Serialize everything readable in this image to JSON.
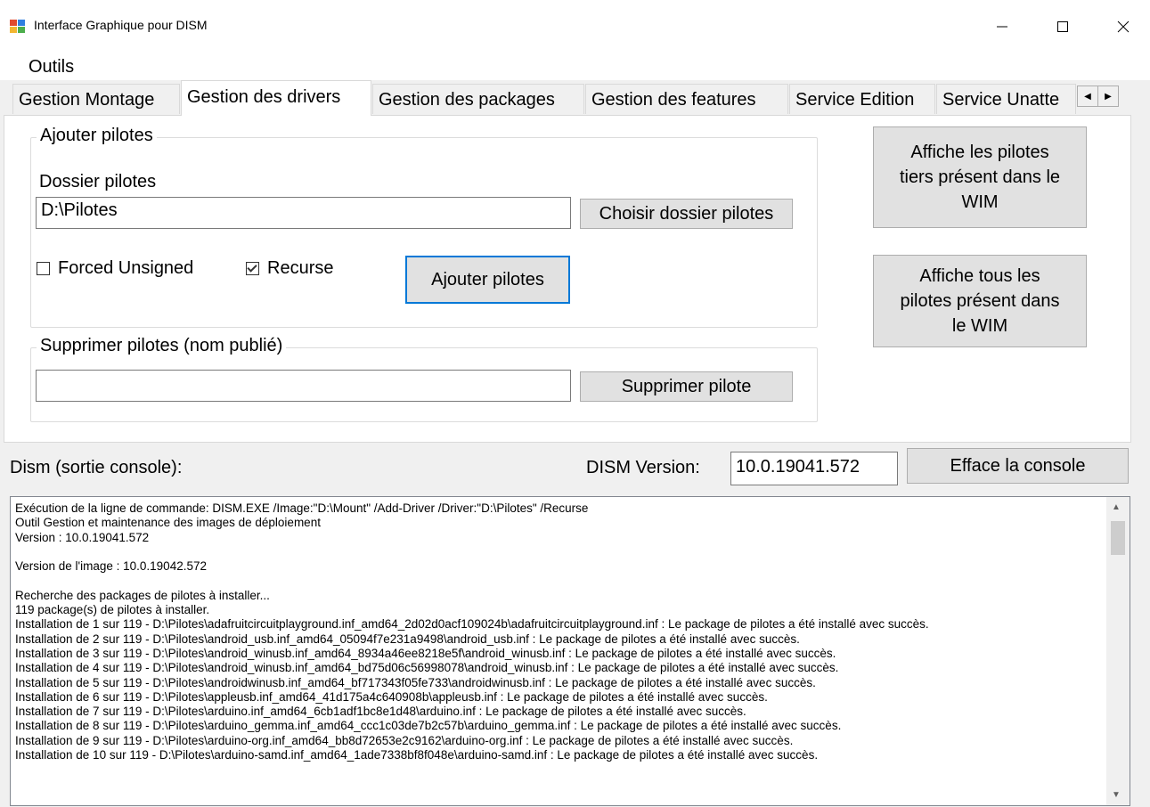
{
  "window": {
    "title": "Interface Graphique pour DISM",
    "minimize_icon": "minimize-icon",
    "maximize_icon": "maximize-icon",
    "close_icon": "close-icon"
  },
  "menu": {
    "items": [
      "Outils"
    ]
  },
  "tabs": [
    "Gestion Montage",
    "Gestion des drivers",
    "Gestion des packages",
    "Gestion des features",
    "Service Edition",
    "Service Unatte"
  ],
  "active_tab": "Gestion des drivers",
  "add_group": {
    "title": "Ajouter pilotes",
    "folder_label": "Dossier pilotes",
    "folder_value": "D:\\Pilotes",
    "choose_button": "Choisir dossier pilotes",
    "forced_unsigned": {
      "label": "Forced Unsigned",
      "checked": false
    },
    "recurse": {
      "label": "Recurse",
      "checked": true
    },
    "add_button": "Ajouter pilotes"
  },
  "remove_group": {
    "title": "Supprimer pilotes (nom publié)",
    "input_value": "",
    "remove_button": "Supprimer pilote"
  },
  "side_buttons": {
    "third_party": [
      "Affiche les pilotes",
      "tiers présent dans le",
      "WIM"
    ],
    "all": [
      "Affiche tous les",
      "pilotes présent dans",
      "le WIM"
    ]
  },
  "console_section": {
    "label": "Dism (sortie console):",
    "version_label": "DISM Version:",
    "version_value": "10.0.19041.572",
    "clear_button": "Efface la console"
  },
  "console_lines": [
    "Exécution de la ligne de commande: DISM.EXE /Image:\"D:\\Mount\" /Add-Driver /Driver:\"D:\\Pilotes\" /Recurse",
    "Outil Gestion et maintenance des images de déploiement",
    "Version : 10.0.19041.572",
    "",
    "Version de l'image : 10.0.19042.572",
    "",
    "Recherche des packages de pilotes à installer...",
    "119 package(s) de pilotes à installer.",
    "Installation de 1 sur 119 - D:\\Pilotes\\adafruitcircuitplayground.inf_amd64_2d02d0acf109024b\\adafruitcircuitplayground.inf : Le package de pilotes a été installé avec succès.",
    "Installation de 2 sur 119 - D:\\Pilotes\\android_usb.inf_amd64_05094f7e231a9498\\android_usb.inf : Le package de pilotes a été installé avec succès.",
    "Installation de 3 sur 119 - D:\\Pilotes\\android_winusb.inf_amd64_8934a46ee8218e5f\\android_winusb.inf : Le package de pilotes a été installé avec succès.",
    "Installation de 4 sur 119 - D:\\Pilotes\\android_winusb.inf_amd64_bd75d06c56998078\\android_winusb.inf : Le package de pilotes a été installé avec succès.",
    "Installation de 5 sur 119 - D:\\Pilotes\\androidwinusb.inf_amd64_bf717343f05fe733\\androidwinusb.inf : Le package de pilotes a été installé avec succès.",
    "Installation de 6 sur 119 - D:\\Pilotes\\appleusb.inf_amd64_41d175a4c640908b\\appleusb.inf : Le package de pilotes a été installé avec succès.",
    "Installation de 7 sur 119 - D:\\Pilotes\\arduino.inf_amd64_6cb1adf1bc8e1d48\\arduino.inf : Le package de pilotes a été installé avec succès.",
    "Installation de 8 sur 119 - D:\\Pilotes\\arduino_gemma.inf_amd64_ccc1c03de7b2c57b\\arduino_gemma.inf : Le package de pilotes a été installé avec succès.",
    "Installation de 9 sur 119 - D:\\Pilotes\\arduino-org.inf_amd64_bb8d72653e2c9162\\arduino-org.inf : Le package de pilotes a été installé avec succès.",
    "Installation de 10 sur 119 - D:\\Pilotes\\arduino-samd.inf_amd64_1ade7338bf8f048e\\arduino-samd.inf : Le package de pilotes a été installé avec succès."
  ]
}
